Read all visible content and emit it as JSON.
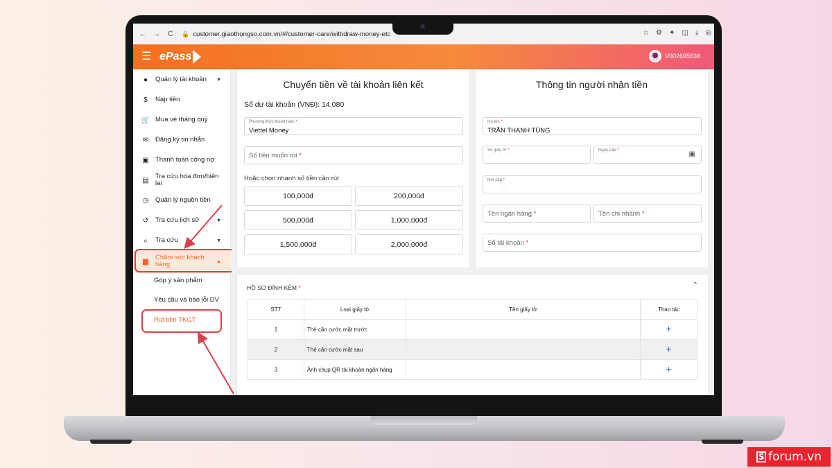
{
  "browser": {
    "url": "customer.giaothongso.com.vn/#/customer-care/withdraw-money-etc",
    "nav_back": "←",
    "nav_forward": "→",
    "nav_reload": "C"
  },
  "header": {
    "brand": "ePass",
    "user_id": "V002695638"
  },
  "sidebar": {
    "items": [
      {
        "label": "Quản lý tài khoản",
        "icon": "account-circle-icon"
      },
      {
        "label": "Nạp tiền",
        "icon": "dollar-icon"
      },
      {
        "label": "Mua vé tháng quý",
        "icon": "cart-icon"
      },
      {
        "label": "Đăng ký tin nhắn",
        "icon": "mail-icon"
      },
      {
        "label": "Thanh toán công nợ",
        "icon": "wallet-icon"
      },
      {
        "label": "Tra cứu hóa đơn/biên lai",
        "icon": "receipt-icon"
      },
      {
        "label": "Quản lý nguồn tiền",
        "icon": "clock-icon"
      },
      {
        "label": "Tra cứu lịch sử",
        "icon": "history-icon"
      },
      {
        "label": "Tra cứu",
        "icon": "search-icon"
      },
      {
        "label": "Chăm sóc khách hàng",
        "icon": "chat-icon"
      }
    ],
    "subitems": [
      "Góp ý sản phẩm",
      "Yêu cầu và báo lỗi DV",
      "Rút tiền TKGT"
    ]
  },
  "transfer": {
    "title": "Chuyển tiền về tài khoản liên kết",
    "balance_label": "Số dư tài khoản (VNĐ): 14,080",
    "method_label": "Phương thức thanh toán",
    "method_value": "Viettel Money",
    "amount_placeholder": "Số tiền muốn rút",
    "quick_label": "Hoặc chọn nhanh số tiền cần rút",
    "amounts": [
      "100,000đ",
      "200,000đ",
      "500,000đ",
      "1,000,000đ",
      "1,500,000đ",
      "2,000,000đ"
    ]
  },
  "recipient": {
    "title": "Thông tin người nhận tiền",
    "name_label": "Họ tên",
    "name_value": "TRẦN THANH TÙNG",
    "id_label": "Số giấy tờ",
    "date_label": "Ngày cấp",
    "place_label": "Nơi cấp",
    "bank_placeholder": "Tên ngân hàng",
    "branch_placeholder": "Tên chi nhánh",
    "account_placeholder": "Số tài khoản"
  },
  "attachments": {
    "title": "HỒ SƠ ĐÍNH KÈM",
    "columns": [
      "STT",
      "Loại giấy tờ",
      "Tên giấy tờ",
      "Thao tác"
    ],
    "rows": [
      {
        "stt": "1",
        "type": "Thẻ căn cước mặt trước"
      },
      {
        "stt": "2",
        "type": "Thẻ căn cước mặt sau"
      },
      {
        "stt": "3",
        "type": "Ảnh chụp QR tài khoản ngân hàng"
      }
    ]
  },
  "watermark": {
    "text": "forum.vn",
    "logo_letter": "S"
  },
  "colors": {
    "brand_orange": "#f37021",
    "brand_pink": "#f0597a",
    "annotation_red": "#d8404a",
    "link_blue": "#2b57c8"
  }
}
